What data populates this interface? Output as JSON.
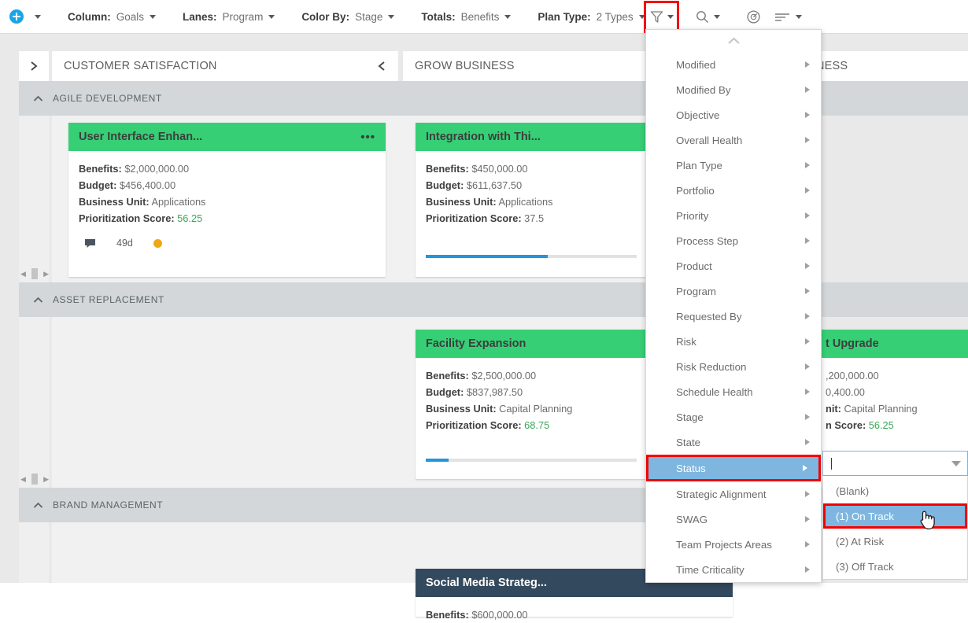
{
  "toolbar": {
    "add_icon": "plus-circle-icon",
    "add_caret": "chevron-down-icon",
    "items": [
      {
        "label": "Column:",
        "value": "Goals"
      },
      {
        "label": "Lanes:",
        "value": "Program"
      },
      {
        "label": "Color By:",
        "value": "Stage"
      },
      {
        "label": "Totals:",
        "value": "Benefits"
      },
      {
        "label": "Plan Type:",
        "value": "2 Types"
      }
    ],
    "filter_icon": "filter-funnel-icon",
    "search_icon": "search-icon",
    "gauge_icon": "gauge-icon",
    "sort_icon": "sort-lines-icon",
    "highlight_color": "#f40000"
  },
  "board": {
    "expander_icon": "chevron-right-icon",
    "columns": [
      {
        "title": "CUSTOMER SATISFACTION",
        "collapse_icon": "chevron-left-icon"
      },
      {
        "title": "GROW BUSINESS",
        "collapse_icon": "chevron-left-icon"
      },
      {
        "title": "NESS",
        "collapse_icon": "chevron-left-icon"
      }
    ],
    "lanes": [
      {
        "title": "AGILE DEVELOPMENT",
        "collapse_icon": "chevron-up-icon"
      },
      {
        "title": "ASSET REPLACEMENT",
        "collapse_icon": "chevron-up-icon"
      },
      {
        "title": "BRAND MANAGEMENT",
        "collapse_icon": "chevron-up-icon"
      }
    ],
    "scroll_left_icon": "triangle-left-icon",
    "scroll_right_icon": "triangle-right-icon"
  },
  "cards": {
    "ui_enhancement": {
      "title": "User Interface Enhan...",
      "menu_icon": "ellipsis-icon",
      "header_color": "#37cf75",
      "benefits_label": "Benefits:",
      "benefits_value": "$2,000,000.00",
      "budget_label": "Budget:",
      "budget_value": "$456,400.00",
      "unit_label": "Business Unit:",
      "unit_value": "Applications",
      "score_label": "Prioritization Score:",
      "score_value": "56.25",
      "comment_icon": "comment-bubble-icon",
      "age": "49d",
      "status_dot": "amber-status-dot"
    },
    "integration": {
      "title": "Integration with Thi...",
      "header_color": "#37cf75",
      "benefits_label": "Benefits:",
      "benefits_value": "$450,000.00",
      "budget_label": "Budget:",
      "budget_value": "$611,637.50",
      "unit_label": "Business Unit:",
      "unit_value": "Applications",
      "score_label": "Prioritization Score:",
      "score_value": "37.5",
      "progress_percent": 58
    },
    "facility": {
      "title": "Facility Expansion",
      "header_color": "#37cf75",
      "benefits_label": "Benefits:",
      "benefits_value": "$2,500,000.00",
      "budget_label": "Budget:",
      "budget_value": "$837,987.50",
      "unit_label": "Business Unit:",
      "unit_value": "Capital Planning",
      "score_label": "Prioritization Score:",
      "score_value": "68.75",
      "progress_percent": 11
    },
    "equipment": {
      "title": "t Upgrade",
      "header_color": "#37cf75",
      "benefits_value": ",200,000.00",
      "budget_value": "0,400.00",
      "unit_label": "nit:",
      "unit_value": "Capital Planning",
      "score_label": "n Score:",
      "score_value": "56.25"
    },
    "social_media": {
      "title": "Social Media Strateg...",
      "header_color": "#33495e",
      "benefits_label": "Benefits:",
      "benefits_value": "$600,000.00"
    }
  },
  "filter_menu": {
    "scroll_up_icon": "chevron-up-icon",
    "items": [
      {
        "label": "Modified",
        "selected": false
      },
      {
        "label": "Modified By",
        "selected": false
      },
      {
        "label": "Objective",
        "selected": false
      },
      {
        "label": "Overall Health",
        "selected": false
      },
      {
        "label": "Plan Type",
        "selected": false
      },
      {
        "label": "Portfolio",
        "selected": false
      },
      {
        "label": "Priority",
        "selected": false
      },
      {
        "label": "Process Step",
        "selected": false
      },
      {
        "label": "Product",
        "selected": false
      },
      {
        "label": "Program",
        "selected": false
      },
      {
        "label": "Requested By",
        "selected": false
      },
      {
        "label": "Risk",
        "selected": false
      },
      {
        "label": "Risk Reduction",
        "selected": false
      },
      {
        "label": "Schedule Health",
        "selected": false
      },
      {
        "label": "Stage",
        "selected": false
      },
      {
        "label": "State",
        "selected": false
      },
      {
        "label": "Status",
        "selected": true
      },
      {
        "label": "Strategic Alignment",
        "selected": false
      },
      {
        "label": "SWAG",
        "selected": false
      },
      {
        "label": "Team Projects Areas",
        "selected": false
      },
      {
        "label": "Time Criticality",
        "selected": false
      }
    ],
    "selection_bg": "#7eb6e0",
    "highlight_border": "#f40000"
  },
  "submenu": {
    "input_value": "",
    "input_caret_icon": "chevron-down-icon",
    "options": [
      {
        "label": "(Blank)",
        "selected": false
      },
      {
        "label": "(1) On Track",
        "selected": true
      },
      {
        "label": "(2) At Risk",
        "selected": false
      },
      {
        "label": "(3) Off Track",
        "selected": false
      }
    ],
    "cursor_icon": "hand-pointer-cursor"
  }
}
